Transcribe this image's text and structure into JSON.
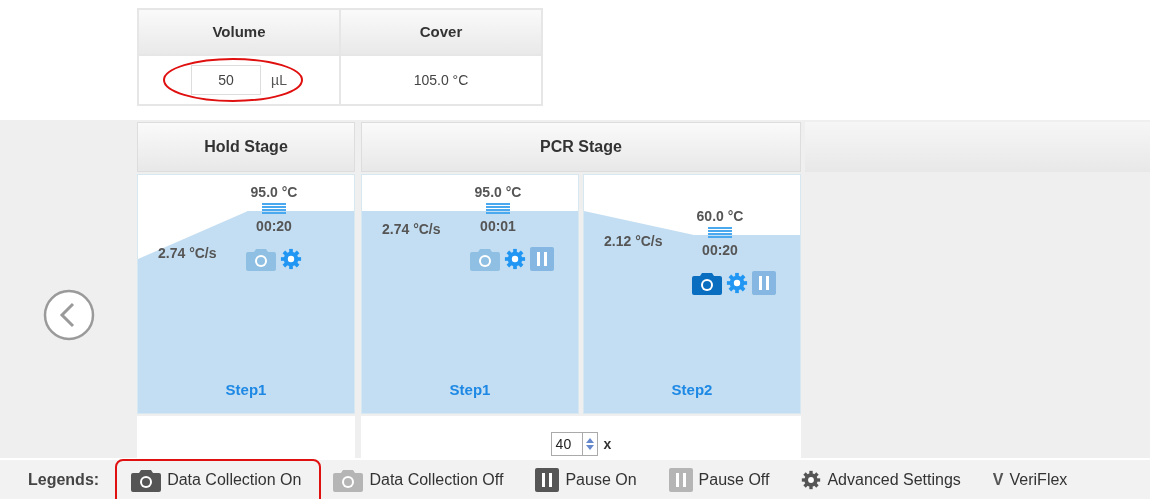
{
  "settings_table": {
    "columns": [
      "Volume",
      "Cover"
    ],
    "volume": {
      "value": "50",
      "unit": "µL"
    },
    "cover": "105.0 °C"
  },
  "stages": [
    {
      "title": "Hold Stage",
      "steps": [
        {
          "name": "Step1",
          "temperature": "95.0 °C",
          "time": "00:20",
          "rate": "2.74 °C/s",
          "level": 0.85,
          "camera_on": false
        }
      ]
    },
    {
      "title": "PCR Stage",
      "cycles": "40",
      "cycles_suffix": "x",
      "steps": [
        {
          "name": "Step1",
          "temperature": "95.0 °C",
          "time": "00:01",
          "rate": "2.74 °C/s",
          "level": 0.85,
          "camera_on": false,
          "pause_on": false
        },
        {
          "name": "Step2",
          "temperature": "60.0 °C",
          "time": "00:20",
          "rate": "2.12 °C/s",
          "level": 0.75,
          "camera_on": true,
          "pause_on": false
        }
      ]
    }
  ],
  "legends": {
    "title": "Legends:",
    "items": [
      {
        "kind": "camera-on",
        "label": "Data Collection On"
      },
      {
        "kind": "camera-off",
        "label": "Data Collection Off"
      },
      {
        "kind": "pause-on",
        "label": "Pause On"
      },
      {
        "kind": "pause-off",
        "label": "Pause Off"
      },
      {
        "kind": "gear",
        "label": "Advanced Settings"
      },
      {
        "kind": "glyph",
        "glyph": "V",
        "label": "VeriFlex"
      }
    ]
  }
}
